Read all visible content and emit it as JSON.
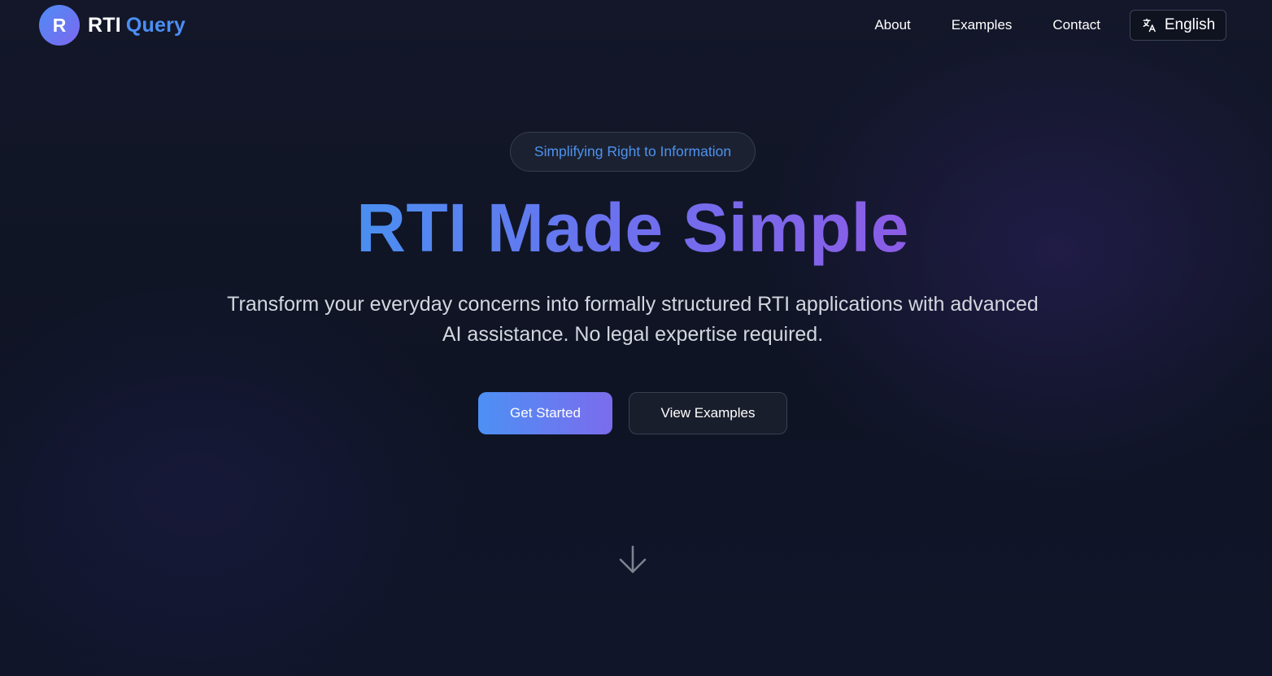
{
  "brand": {
    "badge_letter": "R",
    "name_part1": "RTI",
    "name_part2": "Query"
  },
  "nav": {
    "items": [
      {
        "label": "About"
      },
      {
        "label": "Examples"
      },
      {
        "label": "Contact"
      }
    ],
    "language": {
      "label": "English",
      "icon": "translate-icon"
    }
  },
  "hero": {
    "tagline": "Simplifying Right to Information",
    "title": "RTI Made Simple",
    "description": "Transform your everyday concerns into formally structured RTI applications with advanced AI assistance. No legal expertise required.",
    "primary_button": "Get Started",
    "secondary_button": "View Examples",
    "scroll_icon": "arrow-down-icon"
  },
  "colors": {
    "background": "#0f1422",
    "accent_blue": "#4b8ff2",
    "accent_purple": "#8c5ce6",
    "text_primary": "#ffffff",
    "text_secondary": "#d3d7df"
  }
}
